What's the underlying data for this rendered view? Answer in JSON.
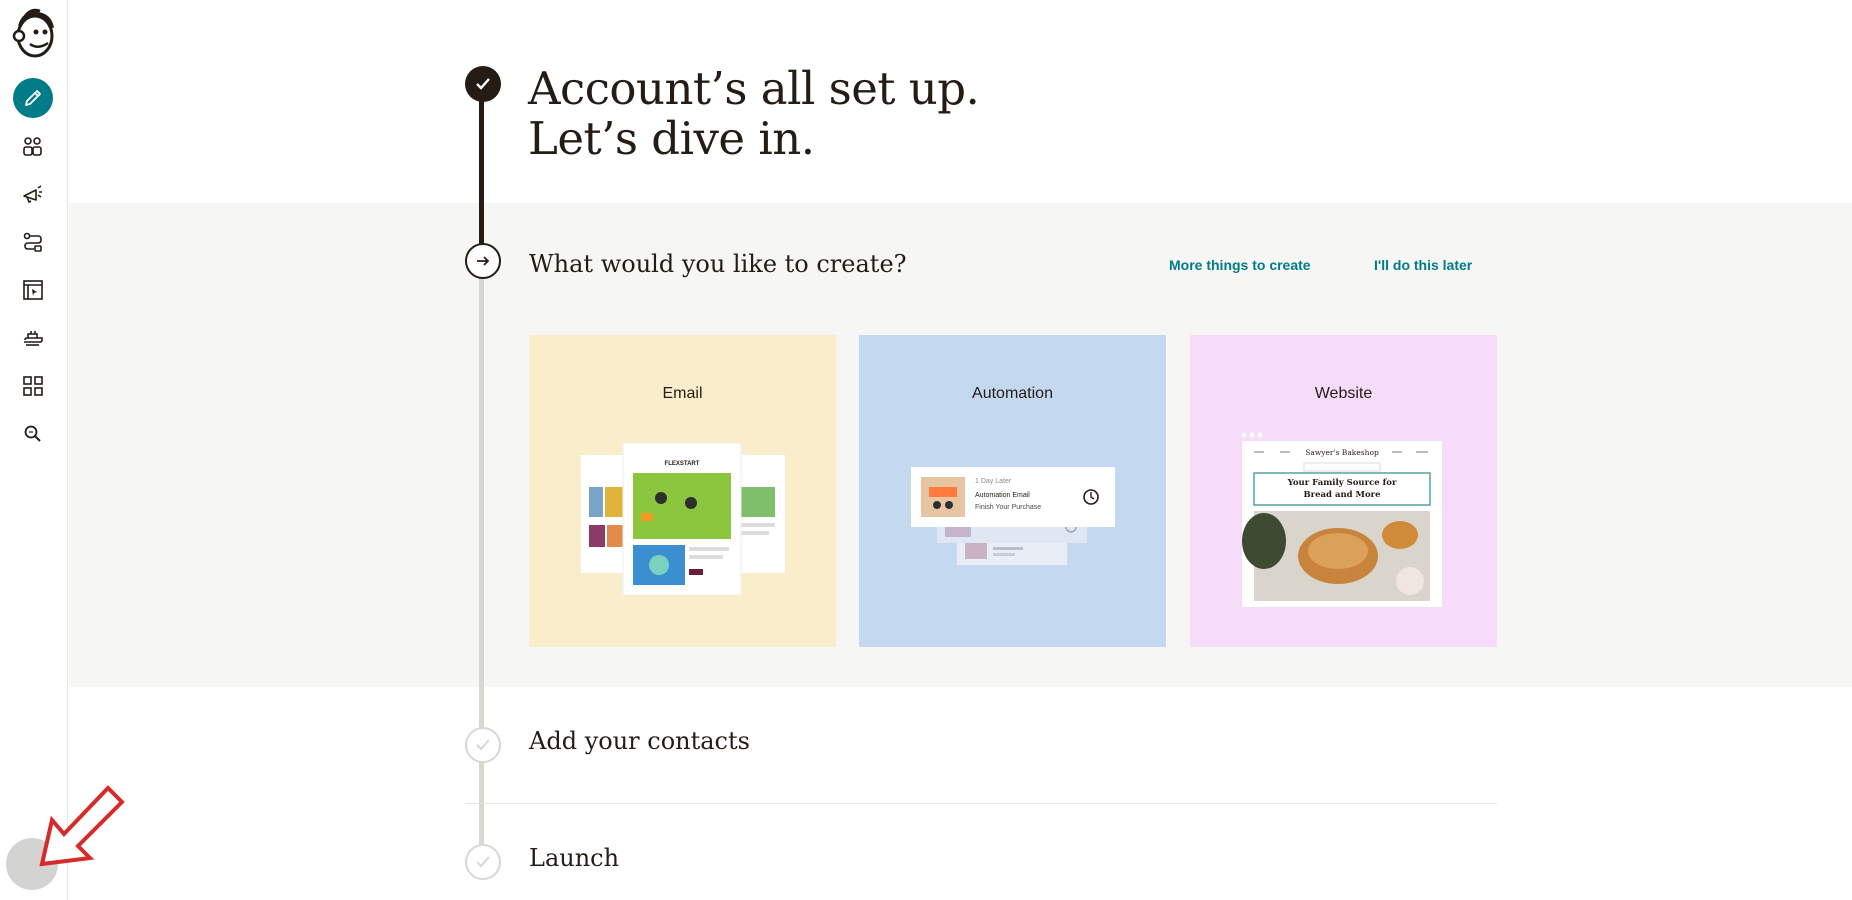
{
  "hero": {
    "line1": "Account’s all set up.",
    "line2": "Let’s dive in."
  },
  "steps": {
    "create": {
      "title": "What would you like to create?",
      "more_link": "More things to create",
      "later_link": "I'll do this later",
      "cards": [
        {
          "label": "Email"
        },
        {
          "label": "Automation"
        },
        {
          "label": "Website"
        }
      ]
    },
    "contacts": {
      "title": "Add your contacts"
    },
    "launch": {
      "title": "Launch"
    }
  },
  "illustrations": {
    "email_brand": "FLEXSTART",
    "automation": {
      "delay": "1 Day Later",
      "name": "Automation Email",
      "subject": "Finish Your Purchase"
    },
    "website": {
      "shop_name": "Sawyer's Bakeshop",
      "headline_1": "Your Family Source for",
      "headline_2": "Bread and More"
    }
  },
  "colors": {
    "accent": "#007c89",
    "ink": "#241c15",
    "email_card": "#f9edcc",
    "automation_card": "#c4d9f0",
    "website_card": "#f6dcf8",
    "band": "#f6f6f4"
  },
  "sidebar_icons": [
    "mailchimp-logo",
    "pencil-icon",
    "audience-icon",
    "megaphone-icon",
    "automation-icon",
    "website-icon",
    "integrations-icon",
    "apps-grid-icon",
    "search-icon",
    "avatar"
  ]
}
